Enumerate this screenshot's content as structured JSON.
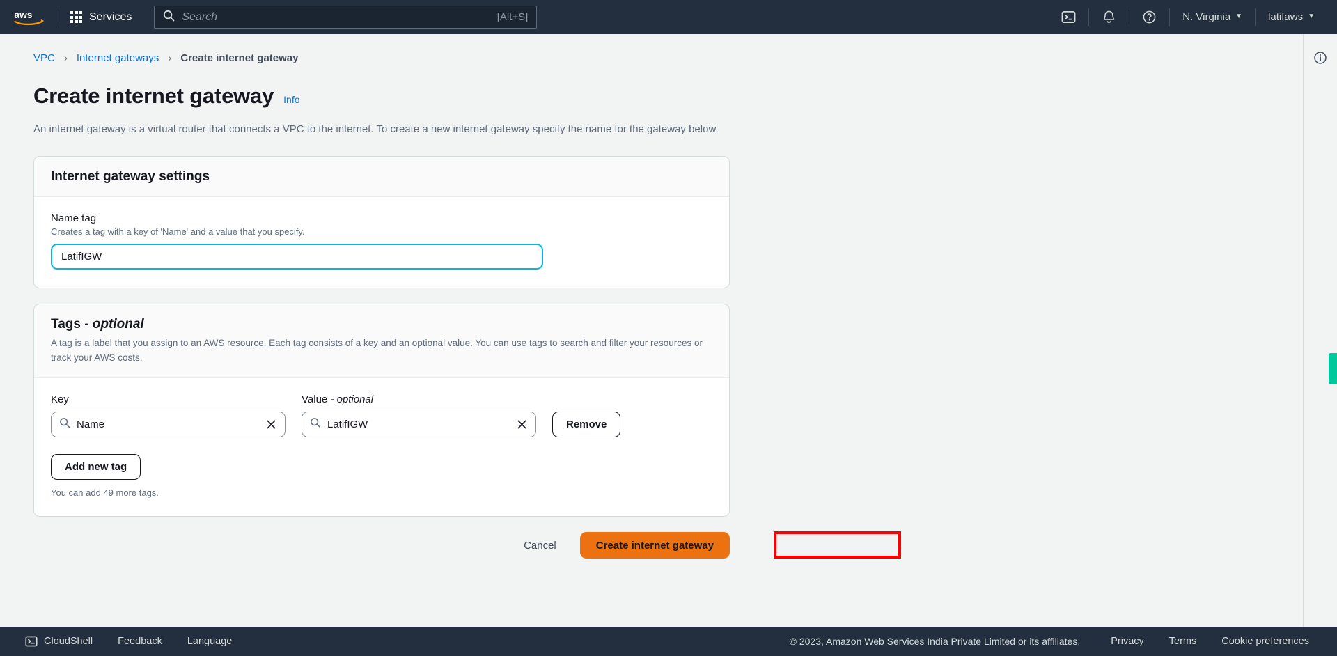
{
  "topnav": {
    "logo_alt": "aws",
    "services_label": "Services",
    "search": {
      "placeholder": "Search",
      "value": "",
      "shortcut": "[Alt+S]"
    },
    "cloudshell_icon": "cloudshell-icon",
    "notifications_icon": "bell-icon",
    "help_icon": "help-circle-icon",
    "region_label": "N. Virginia",
    "account_label": "latifaws",
    "caret": "▼"
  },
  "breadcrumb": {
    "items": [
      {
        "label": "VPC",
        "current": false
      },
      {
        "label": "Internet gateways",
        "current": false
      },
      {
        "label": "Create internet gateway",
        "current": true
      }
    ],
    "separator": "›"
  },
  "page": {
    "title": "Create internet gateway",
    "info_label": "Info",
    "description": "An internet gateway is a virtual router that connects a VPC to the internet. To create a new internet gateway specify the name for the gateway below."
  },
  "settings_panel": {
    "title": "Internet gateway settings",
    "name_tag": {
      "label": "Name tag",
      "hint": "Creates a tag with a key of 'Name' and a value that you specify.",
      "value": "LatifIGW",
      "placeholder": ""
    }
  },
  "tags_panel": {
    "title": "Tags",
    "title_optional": " - optional",
    "description": "A tag is a label that you assign to an AWS resource. Each tag consists of a key and an optional value. You can use tags to search and filter your resources or track your AWS costs.",
    "columns": {
      "key": "Key",
      "value": "Value",
      "value_optional": " - optional"
    },
    "rows": [
      {
        "key": "Name",
        "key_placeholder": "",
        "value": "LatifIGW",
        "value_placeholder": "",
        "remove_label": "Remove"
      }
    ],
    "add_label": "Add new tag",
    "note": "You can add 49 more tags."
  },
  "actions": {
    "cancel_label": "Cancel",
    "submit_label": "Create internet gateway",
    "annotation_box": ""
  },
  "right_rail": {
    "info_icon": "info-circle-icon",
    "accent_color": "#00c89b"
  },
  "bottombar": {
    "cloudshell_label": "CloudShell",
    "feedback_label": "Feedback",
    "language_label": "Language",
    "copyright": "© 2023, Amazon Web Services India Private Limited or its affiliates.",
    "privacy_label": "Privacy",
    "terms_label": "Terms",
    "cookie_label": "Cookie preferences"
  },
  "colors": {
    "nav_bg": "#232f3e",
    "page_bg": "#f2f3f3",
    "link": "#0972d3",
    "primary_button": "#ec7211",
    "focus_border": "#0bb5d9",
    "annotation": "#ff0000"
  }
}
